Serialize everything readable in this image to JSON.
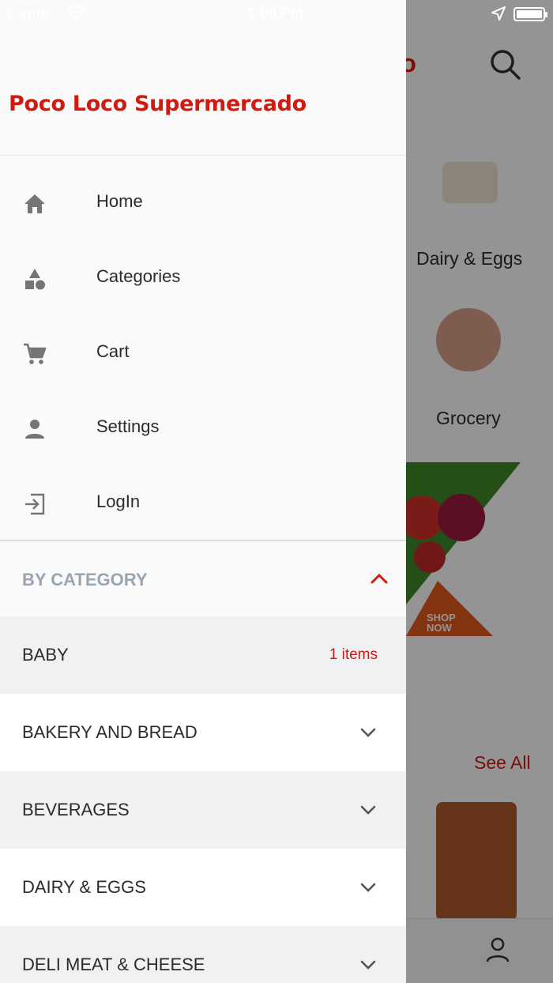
{
  "status_bar": {
    "carrier": "Carrier",
    "time": "1:00 PM"
  },
  "background": {
    "title_fragment": "ado",
    "categories": [
      {
        "label": "Dairy & Eggs"
      },
      {
        "label": "Grocery"
      }
    ],
    "banner_text": "SHOP NOW",
    "see_all": "See All"
  },
  "drawer": {
    "brand": "Poco Loco Supermercado",
    "menu": [
      {
        "label": "Home",
        "icon": "home-icon"
      },
      {
        "label": "Categories",
        "icon": "categories-icon"
      },
      {
        "label": "Cart",
        "icon": "cart-icon"
      },
      {
        "label": "Settings",
        "icon": "person-icon"
      },
      {
        "label": "LogIn",
        "icon": "login-icon"
      }
    ],
    "by_category": {
      "title": "BY CATEGORY",
      "items": [
        {
          "label": "BABY",
          "count": "1 items"
        },
        {
          "label": "BAKERY AND BREAD"
        },
        {
          "label": "BEVERAGES"
        },
        {
          "label": "DAIRY & EGGS"
        },
        {
          "label": "DELI MEAT & CHEESE"
        }
      ]
    }
  },
  "colors": {
    "brand": "#d11a10",
    "category_header": "#9aa5b1",
    "row_alt": "#f0f1f3"
  }
}
